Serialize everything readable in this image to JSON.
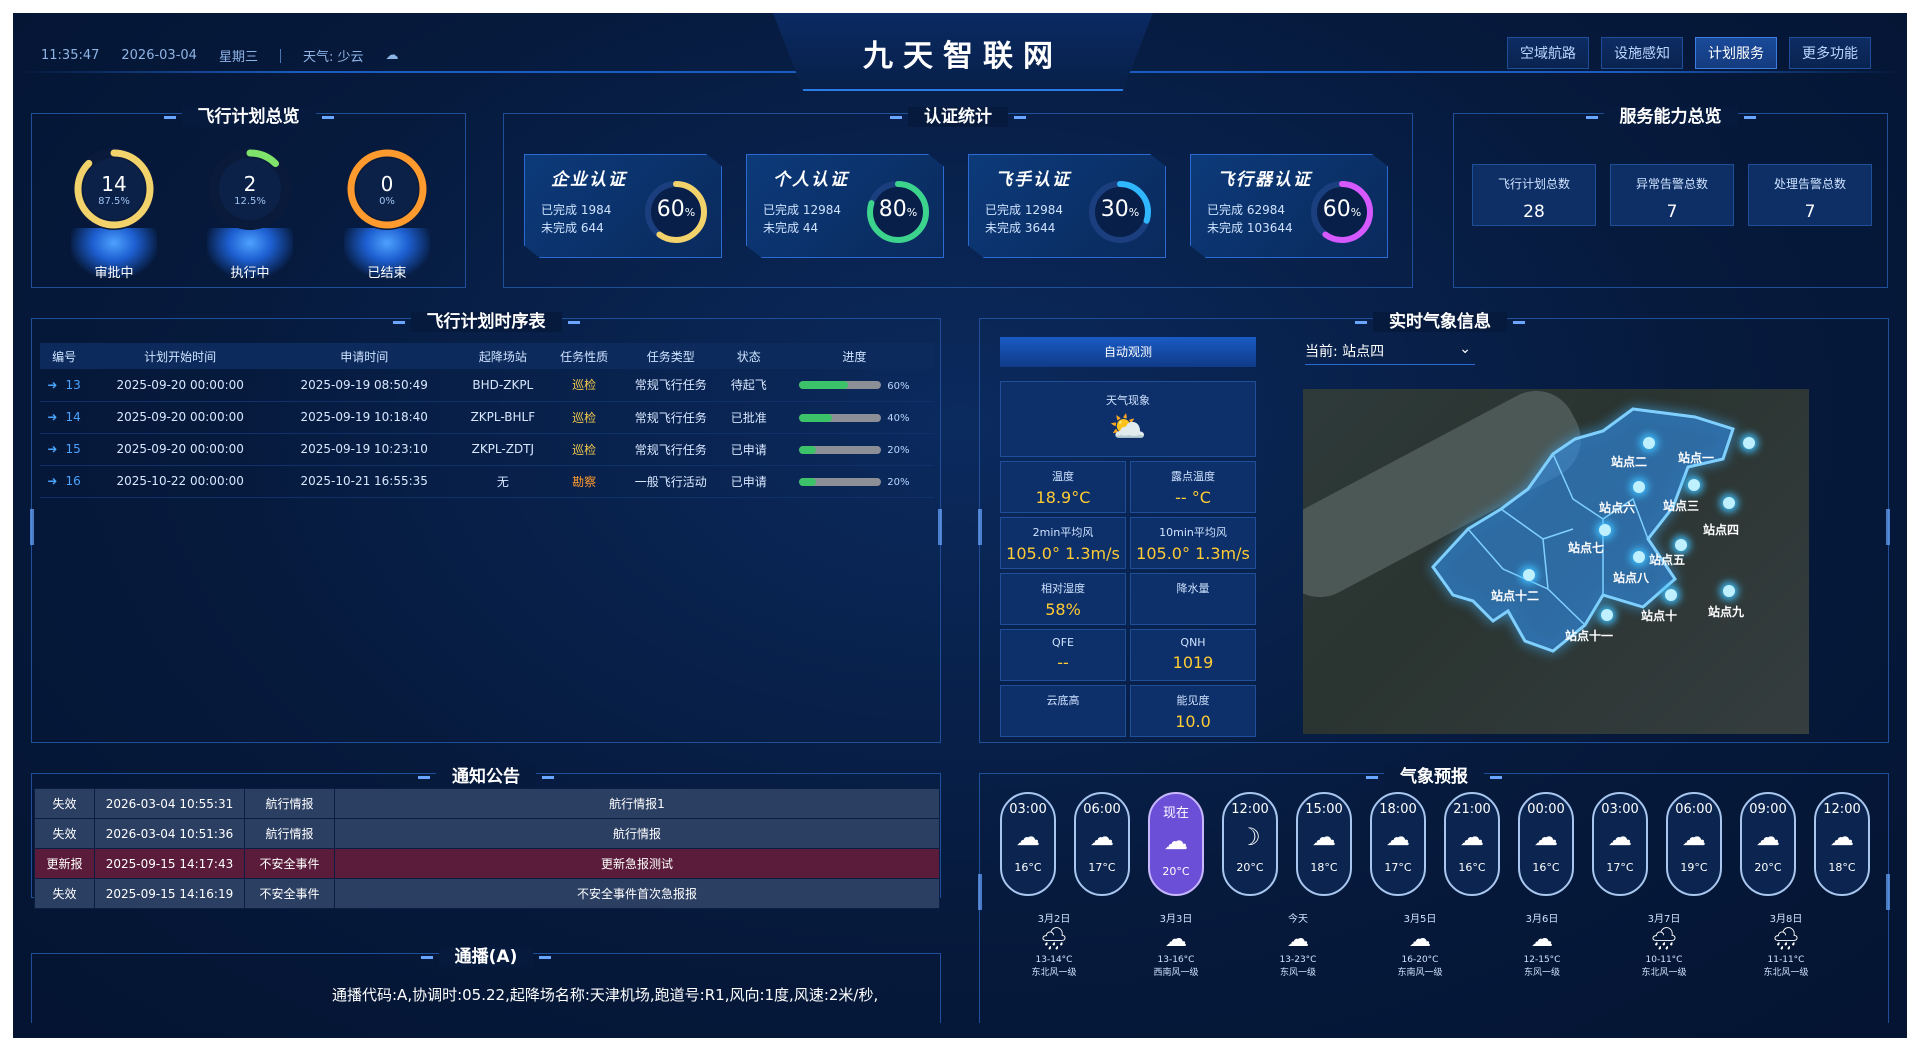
{
  "header": {
    "time": "11:35:47",
    "date": "2026-03-04",
    "weekday": "星期三",
    "weather": "天气: 少云",
    "title": "九天智联网",
    "nav": [
      "空域航路",
      "设施感知",
      "计划服务",
      "更多功能"
    ],
    "nav_active": 2
  },
  "flight_overview": {
    "title": "飞行计划总览",
    "gauges": [
      {
        "label": "审批中",
        "value": "14",
        "pct": "87.5%",
        "fraction": 0.875,
        "color": "#f2d36b"
      },
      {
        "label": "执行中",
        "value": "2",
        "pct": "12.5%",
        "fraction": 0.125,
        "color": "#7fe26a"
      },
      {
        "label": "已结束",
        "value": "0",
        "pct": "0%",
        "fraction": 0.0,
        "color": "#ff9a2e"
      }
    ]
  },
  "cert_stats": {
    "title": "认证统计",
    "cards": [
      {
        "title": "企业认证",
        "done": "已完成 1984",
        "todo": "未完成 644",
        "pct": "60",
        "fraction": 0.6,
        "color": "#f2d36b"
      },
      {
        "title": "个人认证",
        "done": "已完成 12984",
        "todo": "未完成 44",
        "pct": "80",
        "fraction": 0.8,
        "color": "#3cd38c"
      },
      {
        "title": "飞手认证",
        "done": "已完成 12984",
        "todo": "未完成 3644",
        "pct": "30",
        "fraction": 0.3,
        "color": "#2fb8ff"
      },
      {
        "title": "飞行器认证",
        "done": "已完成 62984",
        "todo": "未完成 103644",
        "pct": "60",
        "fraction": 0.6,
        "color": "#d658ff"
      }
    ]
  },
  "service": {
    "title": "服务能力总览",
    "items": [
      {
        "label": "飞行计划总数",
        "value": "28"
      },
      {
        "label": "异常告警总数",
        "value": "7"
      },
      {
        "label": "处理告警总数",
        "value": "7"
      }
    ]
  },
  "schedule": {
    "title": "飞行计划时序表",
    "columns": [
      "编号",
      "计划开始时间",
      "申请时间",
      "起降场站",
      "任务性质",
      "任务类型",
      "状态",
      "进度"
    ],
    "rows": [
      {
        "id": "13",
        "start": "2025-09-20 00:00:00",
        "apply": "2025-09-19 08:50:49",
        "site": "BHD-ZKPL",
        "nature": "巡检",
        "type": "常规飞行任务",
        "status": "待起飞",
        "progress": "60%",
        "fraction": 0.6
      },
      {
        "id": "14",
        "start": "2025-09-20 00:00:00",
        "apply": "2025-09-19 10:18:40",
        "site": "ZKPL-BHLF",
        "nature": "巡检",
        "type": "常规飞行任务",
        "status": "已批准",
        "progress": "40%",
        "fraction": 0.4
      },
      {
        "id": "15",
        "start": "2025-09-20 00:00:00",
        "apply": "2025-09-19 10:23:10",
        "site": "ZKPL-ZDTJ",
        "nature": "巡检",
        "type": "常规飞行任务",
        "status": "已申请",
        "progress": "20%",
        "fraction": 0.2
      },
      {
        "id": "16",
        "start": "2025-10-22 00:00:00",
        "apply": "2025-10-21 16:55:35",
        "site": "无",
        "nature": "勘察",
        "type": "一般飞行活动",
        "status": "已申请",
        "progress": "20%",
        "fraction": 0.2
      }
    ]
  },
  "notice": {
    "title": "通知公告",
    "rows": [
      {
        "status": "失效",
        "time": "2026-03-04 10:55:31",
        "category": "航行情报",
        "content": "航行情报1"
      },
      {
        "status": "失效",
        "time": "2026-03-04 10:51:36",
        "category": "航行情报",
        "content": "航行情报"
      },
      {
        "status": "更新报",
        "time": "2025-09-15 14:17:43",
        "category": "不安全事件",
        "content": "更新急报测试"
      },
      {
        "status": "失效",
        "time": "2025-09-15 14:16:19",
        "category": "不安全事件",
        "content": "不安全事件首次急报报"
      }
    ]
  },
  "broadcast": {
    "title": "通播(A)",
    "text": "通播代码:A,协调时:05.22,起降场名称:天津机场,跑道号:R1,风向:1度,风速:2米/秒,"
  },
  "weather_realtime": {
    "title": "实时气象信息",
    "station_button": "自动观测",
    "current_label": "当前: 站点四",
    "phenomenon_label": "天气现象",
    "cells": [
      {
        "label": "温度",
        "value": "18.9°C"
      },
      {
        "label": "露点温度",
        "value": "-- °C"
      },
      {
        "label": "2min平均风",
        "value": "105.0° 1.3m/s"
      },
      {
        "label": "10min平均风",
        "value": "105.0° 1.3m/s"
      },
      {
        "label": "相对湿度",
        "value": "58%"
      },
      {
        "label": "降水量",
        "value": ""
      },
      {
        "label": "QFE",
        "value": "--"
      },
      {
        "label": "QNH",
        "value": "1019"
      },
      {
        "label": "云底高",
        "value": ""
      },
      {
        "label": "能见度",
        "value": "10.0"
      }
    ],
    "stations": [
      "站点一",
      "站点二",
      "站点三",
      "站点四",
      "站点五",
      "站点六",
      "站点七",
      "站点八",
      "站点九",
      "站点十",
      "站点十一",
      "站点十二"
    ]
  },
  "forecast": {
    "title": "气象预报",
    "hours": [
      {
        "time": "03:00",
        "temp": "16°C",
        "icon": "cloud"
      },
      {
        "time": "06:00",
        "temp": "17°C",
        "icon": "cloud"
      },
      {
        "time": "现在",
        "temp": "20°C",
        "icon": "cloud"
      },
      {
        "time": "12:00",
        "temp": "20°C",
        "icon": "moon"
      },
      {
        "time": "15:00",
        "temp": "18°C",
        "icon": "cloud"
      },
      {
        "time": "18:00",
        "temp": "17°C",
        "icon": "cloud"
      },
      {
        "time": "21:00",
        "temp": "16°C",
        "icon": "cloud"
      },
      {
        "time": "00:00",
        "temp": "16°C",
        "icon": "cloud"
      },
      {
        "time": "03:00",
        "temp": "17°C",
        "icon": "cloud"
      },
      {
        "time": "06:00",
        "temp": "19°C",
        "icon": "cloud"
      },
      {
        "time": "09:00",
        "temp": "20°C",
        "icon": "cloud"
      },
      {
        "time": "12:00",
        "temp": "18°C",
        "icon": "cloud"
      }
    ],
    "now_index": 2,
    "days": [
      {
        "date": "3月2日",
        "range": "13-14°C",
        "wind": "东北风一级",
        "icon": "rain"
      },
      {
        "date": "3月3日",
        "range": "13-16°C",
        "wind": "西南风一级",
        "icon": "cloud"
      },
      {
        "date": "今天",
        "range": "13-23°C",
        "wind": "东风一级",
        "icon": "cloud"
      },
      {
        "date": "3月5日",
        "range": "16-20°C",
        "wind": "东南风一级",
        "icon": "cloud"
      },
      {
        "date": "3月6日",
        "range": "12-15°C",
        "wind": "东风一级",
        "icon": "cloud"
      },
      {
        "date": "3月7日",
        "range": "10-11°C",
        "wind": "东北风一级",
        "icon": "rain"
      },
      {
        "date": "3月8日",
        "range": "11-11°C",
        "wind": "东北风一级",
        "icon": "rain"
      }
    ]
  }
}
